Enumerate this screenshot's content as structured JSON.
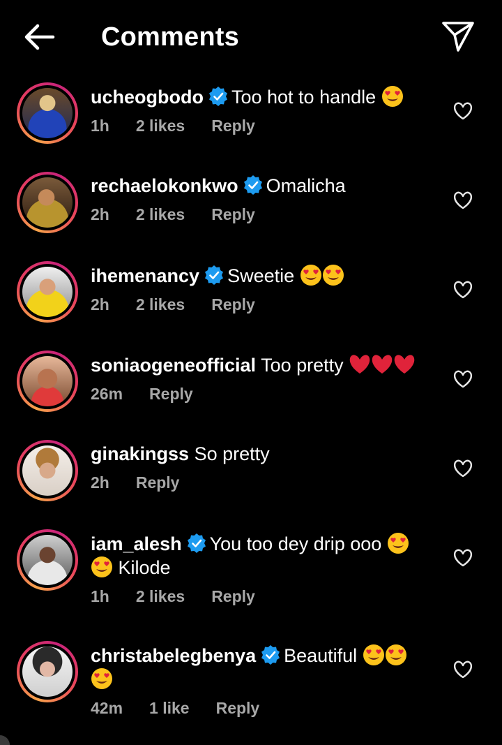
{
  "header": {
    "title": "Comments",
    "back_icon": "arrow-left-icon",
    "share_icon": "paper-plane-icon"
  },
  "comments": [
    {
      "username": "ucheogbodo",
      "verified": true,
      "text": "Too hot to handle",
      "emoji_after": [
        "heart-eyes-emoji"
      ],
      "time": "1h",
      "likes": "2 likes",
      "reply": "Reply"
    },
    {
      "username": "rechaelokonkwo",
      "verified": true,
      "text": "Omalicha",
      "time": "2h",
      "likes": "2 likes",
      "reply": "Reply"
    },
    {
      "username": "ihemenancy",
      "verified": true,
      "text": "Sweetie",
      "emoji_after": [
        "heart-eyes-emoji",
        "heart-eyes-emoji"
      ],
      "time": "2h",
      "likes": "2 likes",
      "reply": "Reply"
    },
    {
      "username": "soniaogeneofficial",
      "verified": false,
      "text": "Too pretty",
      "emoji_after": [
        "red-heart-emoji",
        "red-heart-emoji",
        "red-heart-emoji"
      ],
      "time": "26m",
      "reply": "Reply"
    },
    {
      "username": "ginakingss",
      "verified": false,
      "text": "So pretty",
      "time": "2h",
      "reply": "Reply"
    },
    {
      "username": "iam_alesh",
      "verified": true,
      "text": "You too dey drip ooo",
      "text2": "Kilode",
      "emoji_after": [
        "heart-eyes-emoji",
        "heart-eyes-emoji"
      ],
      "time": "1h",
      "likes": "2 likes",
      "reply": "Reply"
    },
    {
      "username": "christabelegbenya",
      "verified": true,
      "text": "Beautiful",
      "emoji_after": [
        "heart-eyes-emoji",
        "heart-eyes-emoji",
        "heart-eyes-emoji"
      ],
      "time": "42m",
      "likes": "1 like",
      "reply": "Reply"
    }
  ],
  "colors": {
    "background": "#000000",
    "meta_text": "#a8a8a8",
    "verified_blue": "#1d9bf0",
    "ring_orange": "#f7a34b",
    "ring_pink": "#c9247a"
  }
}
